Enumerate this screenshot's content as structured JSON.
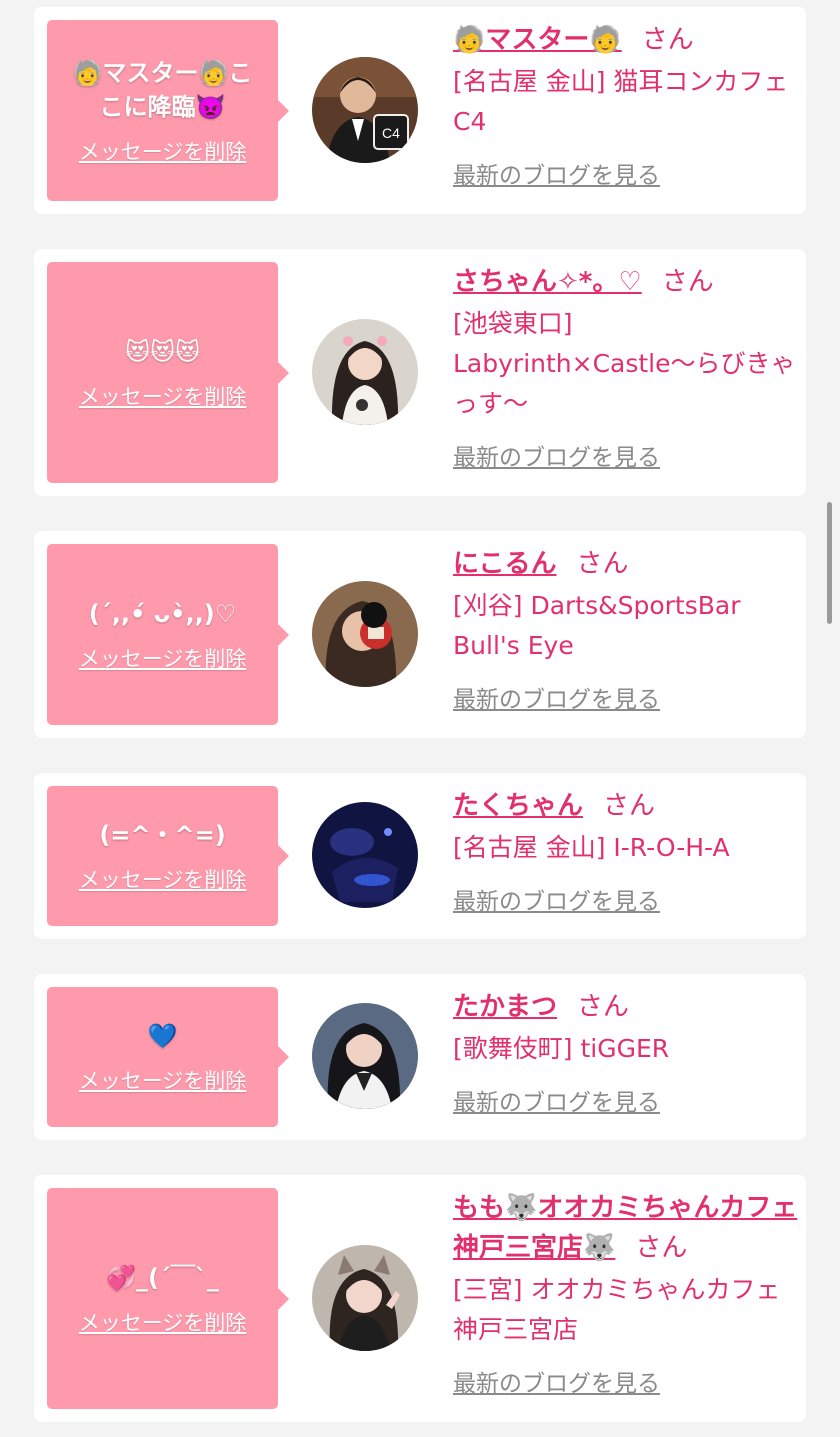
{
  "common": {
    "delete_label": "メッセージを削除",
    "blog_label": "最新のブログを見る",
    "honorific": "さん"
  },
  "colors": {
    "accent": "#e1306c",
    "bubble": "#fe9aac",
    "link_gray": "#8a8a8a",
    "page_bg": "#f3f3f3"
  },
  "items": [
    {
      "message": "🧓マスター🧓ここに降臨👿",
      "name": "🧓マスター🧓",
      "shop": "[名古屋 金山] 猫耳コンカフェ C4"
    },
    {
      "message": "😻😻😻",
      "name": "さちゃん✧*。♡",
      "shop": "[池袋東口] Labyrinth×Castle〜らびきゃっす〜"
    },
    {
      "message": "(ˊ,,•́ ᴗ•̀,,)♡",
      "name": "にこるん",
      "shop": "[刈谷] Darts&SportsBar Bull's Eye"
    },
    {
      "message": "(=^・^=)",
      "name": "たくちゃん",
      "shop": "[名古屋 金山] I-R-O-H-A"
    },
    {
      "message": "💙",
      "name": "たかまつ",
      "shop": "[歌舞伎町] tiGGER"
    },
    {
      "message": "💞_(´￣`_",
      "name": "もも🐺オオカミちゃんカフェ神戸三宮店🐺",
      "shop": "[三宮] オオカミちゃんカフェ神戸三宮店"
    }
  ]
}
